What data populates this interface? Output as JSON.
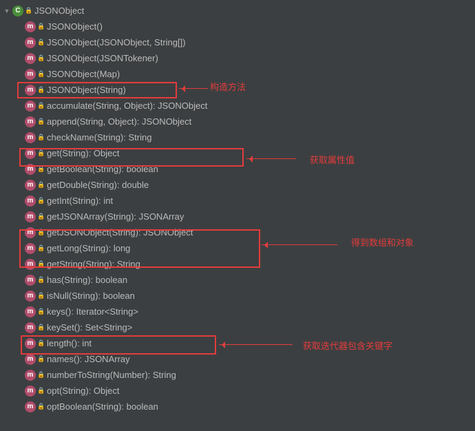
{
  "root": {
    "name": "JSONObject",
    "icon": "C"
  },
  "members": [
    {
      "label": "JSONObject()"
    },
    {
      "label": "JSONObject(JSONObject, String[])"
    },
    {
      "label": "JSONObject(JSONTokener)"
    },
    {
      "label": "JSONObject(Map)"
    },
    {
      "label": "JSONObject(String)"
    },
    {
      "label": "accumulate(String, Object): JSONObject"
    },
    {
      "label": "append(String, Object): JSONObject"
    },
    {
      "label": "checkName(String): String"
    },
    {
      "label": "get(String): Object"
    },
    {
      "label": "getBoolean(String): boolean"
    },
    {
      "label": "getDouble(String): double"
    },
    {
      "label": "getInt(String): int"
    },
    {
      "label": "getJSONArray(String): JSONArray"
    },
    {
      "label": "getJSONObject(String): JSONObject"
    },
    {
      "label": "getLong(String): long"
    },
    {
      "label": "getString(String): String"
    },
    {
      "label": "has(String): boolean"
    },
    {
      "label": "isNull(String): boolean"
    },
    {
      "label": "keys(): Iterator<String>"
    },
    {
      "label": "keySet(): Set<String>"
    },
    {
      "label": "length(): int"
    },
    {
      "label": "names(): JSONArray"
    },
    {
      "label": "numberToString(Number): String"
    },
    {
      "label": "opt(String): Object"
    },
    {
      "label": "optBoolean(String): boolean"
    }
  ],
  "annotations": {
    "constructor": "构造方法",
    "getAttr": "获取属性值",
    "getArrObj": "得到数组和对象",
    "iterator": "获取迭代器包含关键字"
  }
}
